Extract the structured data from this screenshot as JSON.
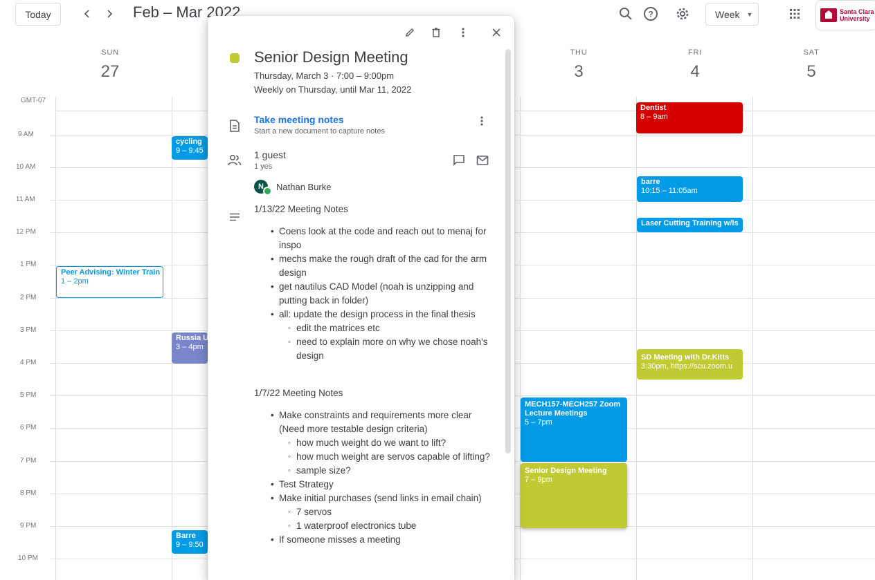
{
  "header": {
    "today_label": "Today",
    "date_range": "Feb – Mar 2022",
    "view_label": "Week",
    "org_name": "Santa Clara\nUniversity"
  },
  "days": [
    {
      "dow": "SUN",
      "num": "27"
    },
    {
      "dow": "THU",
      "num": "3"
    },
    {
      "dow": "FRI",
      "num": "4"
    },
    {
      "dow": "SAT",
      "num": "5"
    }
  ],
  "timezone": "GMT-07",
  "hours": [
    "9 AM",
    "10 AM",
    "11 AM",
    "12 PM",
    "1 PM",
    "2 PM",
    "3 PM",
    "4 PM",
    "5 PM",
    "6 PM",
    "7 PM",
    "8 PM",
    "9 PM",
    "10 PM"
  ],
  "events": {
    "dentist": {
      "title": "Dentist",
      "time": "8 – 9am"
    },
    "cycling": {
      "title": "cycling",
      "time": "9 – 9:45"
    },
    "barre_fri": {
      "title": "barre",
      "time": "10:15 – 11:05am"
    },
    "laser": {
      "title": "Laser Cutting Training w/Is"
    },
    "peer": {
      "title": "Peer Advising: Winter Train",
      "time": "1 – 2pm"
    },
    "russia": {
      "title": "Russia U",
      "time": "3 – 4pm"
    },
    "sd_kitts": {
      "title": "SD Meeting with Dr.Kitts",
      "time": "3:30pm, https://scu.zoom.u"
    },
    "mech": {
      "title": "MECH157-MECH257 Zoom Lecture Meetings",
      "time": "5 – 7pm"
    },
    "senior": {
      "title": "Senior Design Meeting",
      "time": "7 – 9pm"
    },
    "barre_mon": {
      "title": "Barre",
      "time": "9 – 9:50"
    }
  },
  "popup": {
    "title": "Senior Design Meeting",
    "when": "Thursday, March 3  ·  7:00 – 9:00pm",
    "recurrence": "Weekly on Thursday, until Mar 11, 2022",
    "notes_link": "Take meeting notes",
    "notes_sub": "Start a new document to capture notes",
    "guest_count": "1 guest",
    "guest_yes": "1 yes",
    "guest_initial": "N",
    "guest_name": "Nathan Burke",
    "color": "#c0ca33",
    "description": {
      "heading1": "1/13/22 Meeting Notes",
      "b1": "Coens look at the code and reach out to menaj for inspo",
      "b2": "mechs make the rough draft of the cad for the arm design",
      "b3": "get nautilus CAD Model (noah is unzipping and putting back in folder)",
      "b4": "all: update the design process in the final thesis",
      "b4a": "edit the matrices etc",
      "b4b": "need to explain more on why we chose noah's design",
      "heading2": "1/7/22 Meeting Notes",
      "c1": "Make constraints and requirements more clear (Need more testable design criteria)",
      "c1a": "how much weight do we want to lift?",
      "c1b": "how much weight are servos capable of lifting?",
      "c1c": "sample size?",
      "c2": "Test Strategy",
      "c3": "Make initial purchases (send links in email chain)",
      "c3a": "7 servos",
      "c3b": "1 waterproof electronics tube",
      "c4": "If someone misses a meeting"
    }
  },
  "colors": {
    "blue": "#039be5",
    "red": "#d50000",
    "lavender": "#7986cb",
    "olive": "#c0ca33",
    "link": "#1a73e8"
  },
  "icons": [
    "chevron-left-icon",
    "chevron-right-icon",
    "search-icon",
    "help-icon",
    "settings-icon",
    "apps-grid-icon",
    "edit-icon",
    "delete-icon",
    "more-vert-icon",
    "close-icon",
    "document-icon",
    "people-icon",
    "chat-icon",
    "mail-icon",
    "notes-icon"
  ]
}
